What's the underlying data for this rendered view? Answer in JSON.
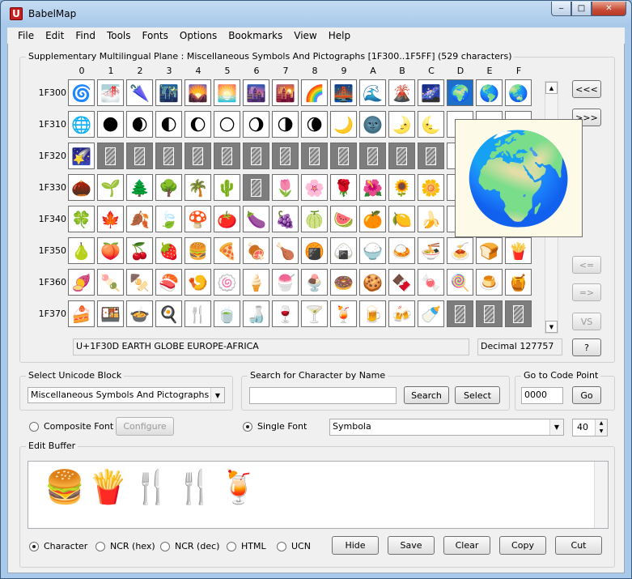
{
  "window": {
    "title": "BabelMap",
    "minimize": "‒",
    "maximize": "□",
    "close": "✕"
  },
  "menu": [
    "File",
    "Edit",
    "Find",
    "Tools",
    "Fonts",
    "Options",
    "Bookmarks",
    "View",
    "Help"
  ],
  "grid": {
    "heading": "Supplementary Multilingual Plane : Miscellaneous Symbols And Pictographs [1F300..1F5FF] (529 characters)",
    "columns": [
      "0",
      "1",
      "2",
      "3",
      "4",
      "5",
      "6",
      "7",
      "8",
      "9",
      "A",
      "B",
      "C",
      "D",
      "E",
      "F"
    ],
    "rows": [
      {
        "label": "1F300",
        "cells": [
          "🌀",
          "🌁",
          "🌂",
          "🌃",
          "🌄",
          "🌅",
          "🌆",
          "🌇",
          "🌈",
          "🌉",
          "🌊",
          "🌋",
          "🌌",
          "🌍",
          "🌎",
          "🌏"
        ]
      },
      {
        "label": "1F310",
        "cells": [
          "🌐",
          "🌑",
          "🌒",
          "🌓",
          "🌔",
          "🌕",
          "🌖",
          "🌗",
          "🌘",
          "🌙",
          "🌚",
          "🌛",
          "🌜",
          "",
          "",
          ""
        ]
      },
      {
        "label": "1F320",
        "cells": [
          "🌠",
          "",
          "",
          "",
          "",
          "",
          "",
          "",
          "",
          "",
          "",
          "",
          "",
          "",
          "",
          ""
        ]
      },
      {
        "label": "1F330",
        "cells": [
          "🌰",
          "🌱",
          "🌲",
          "🌳",
          "🌴",
          "🌵",
          "",
          "🌷",
          "🌸",
          "🌹",
          "🌺",
          "🌻",
          "🌼",
          "",
          "",
          ""
        ]
      },
      {
        "label": "1F340",
        "cells": [
          "🍀",
          "🍁",
          "🍂",
          "🍃",
          "🍄",
          "🍅",
          "🍆",
          "🍇",
          "🍈",
          "🍉",
          "🍊",
          "🍋",
          "🍌",
          "",
          "",
          ""
        ]
      },
      {
        "label": "1F350",
        "cells": [
          "🍐",
          "🍑",
          "🍒",
          "🍓",
          "🍔",
          "🍕",
          "🍖",
          "🍗",
          "🍘",
          "🍙",
          "🍚",
          "🍛",
          "🍜",
          "🍝",
          "🍞",
          "🍟"
        ]
      },
      {
        "label": "1F360",
        "cells": [
          "🍠",
          "🍡",
          "🍢",
          "🍣",
          "🍤",
          "🍥",
          "🍦",
          "🍧",
          "🍨",
          "🍩",
          "🍪",
          "🍫",
          "🍬",
          "🍭",
          "🍮",
          "🍯"
        ]
      },
      {
        "label": "1F370",
        "cells": [
          "🍰",
          "🍱",
          "🍲",
          "🍳",
          "🍴",
          "🍵",
          "🍶",
          "🍷",
          "🍸",
          "🍹",
          "🍺",
          "🍻",
          "🍼",
          "",
          "",
          ""
        ]
      }
    ],
    "placeholder_cells": [
      "1F321",
      "1F322",
      "1F323",
      "1F324",
      "1F325",
      "1F326",
      "1F327",
      "1F328",
      "1F329",
      "1F32A",
      "1F32B",
      "1F32C",
      "1F336",
      "1F37D",
      "1F37E",
      "1F37F"
    ],
    "selected_cell": "1F30D",
    "preview_glyph": "🌍"
  },
  "nav_buttons": [
    "<<<",
    ">>>",
    "<=",
    "=>",
    "VS",
    "?"
  ],
  "status": {
    "char_name": "U+1F30D EARTH GLOBE EUROPE-AFRICA",
    "decimal": "Decimal 127757"
  },
  "block_select": {
    "label": "Select Unicode Block",
    "value": "Miscellaneous Symbols And Pictographs"
  },
  "search": {
    "label": "Search for Character by Name",
    "value": "",
    "search_btn": "Search",
    "select_btn": "Select"
  },
  "goto": {
    "label": "Go to Code Point",
    "value": "0000",
    "go_btn": "Go"
  },
  "font": {
    "composite_label": "Composite Font",
    "configure_btn": "Configure",
    "single_label": "Single Font",
    "font_value": "Symbola",
    "size": "40",
    "mode": "single"
  },
  "edit_buffer": {
    "label": "Edit Buffer",
    "content": "🍔🍟🍴🍴🍹"
  },
  "output_modes": [
    "Character",
    "NCR (hex)",
    "NCR (dec)",
    "HTML",
    "UCN"
  ],
  "selected_output": "Character",
  "buffer_buttons": [
    "Hide",
    "Save",
    "Clear",
    "Copy",
    "Cut"
  ],
  "colors": {
    "selection": "#1e6fc9",
    "placeholder": "#7d7d7d",
    "preview_bg": "#fdfbe7"
  }
}
